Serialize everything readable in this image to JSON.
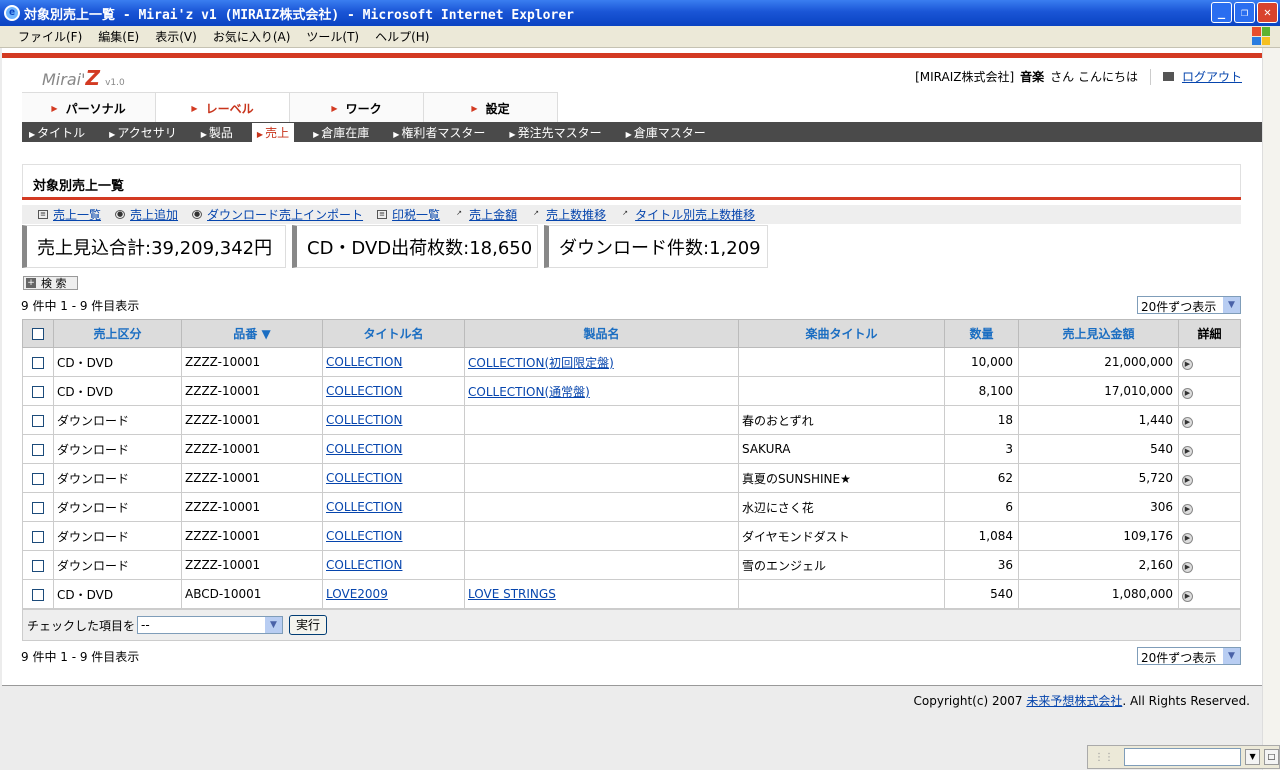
{
  "window": {
    "title": "対象別売上一覧 - Mirai'z v1 (MIRAIZ株式会社) - Microsoft Internet Explorer"
  },
  "menubar": [
    "ファイル(F)",
    "編集(E)",
    "表示(V)",
    "お気に入り(A)",
    "ツール(T)",
    "ヘルプ(H)"
  ],
  "header": {
    "logo_text": "Mirai'",
    "logo_z": "Z",
    "logo_version": "v1.0",
    "company": "[MIRAIZ株式会社]",
    "user": "音楽",
    "greeting": "さん こんにちは",
    "logout": "ログアウト"
  },
  "tabs": [
    "パーソナル",
    "レーベル",
    "ワーク",
    "設定"
  ],
  "active_tab": "レーベル",
  "subnav": [
    "タイトル",
    "アクセサリ",
    "製品",
    "売上",
    "倉庫在庫",
    "権利者マスター",
    "発注先マスター",
    "倉庫マスター"
  ],
  "active_subnav": "売上",
  "page_title": "対象別売上一覧",
  "actions": [
    {
      "label": "売上一覧",
      "icon": "list-icon"
    },
    {
      "label": "売上追加",
      "icon": "add-icon"
    },
    {
      "label": "ダウンロード売上インポート",
      "icon": "import-icon"
    },
    {
      "label": "印税一覧",
      "icon": "list-icon"
    },
    {
      "label": "売上金額",
      "icon": "chart-icon"
    },
    {
      "label": "売上数推移",
      "icon": "chart-icon"
    },
    {
      "label": "タイトル別売上数推移",
      "icon": "chart-icon"
    }
  ],
  "stats": {
    "total_sales": "売上見込合計:39,209,342円",
    "cd_dvd": "CD・DVD出荷枚数:18,650",
    "downloads": "ダウンロード件数:1,209"
  },
  "search_label": "検 索",
  "result_count": "9 件中 1 - 9 件目表示",
  "per_page": "20件ずつ表示",
  "table": {
    "columns": [
      "売上区分",
      "品番 ▼",
      "タイトル名",
      "製品名",
      "楽曲タイトル",
      "数量",
      "売上見込金額",
      "詳細"
    ],
    "rows": [
      {
        "type": "CD・DVD",
        "code": "ZZZZ-10001",
        "title": "COLLECTION",
        "product": "COLLECTION(初回限定盤)",
        "song": "",
        "qty": "10,000",
        "amount": "21,000,000"
      },
      {
        "type": "CD・DVD",
        "code": "ZZZZ-10001",
        "title": "COLLECTION",
        "product": "COLLECTION(通常盤)",
        "song": "",
        "qty": "8,100",
        "amount": "17,010,000"
      },
      {
        "type": "ダウンロード",
        "code": "ZZZZ-10001",
        "title": "COLLECTION",
        "product": "",
        "song": "春のおとずれ",
        "qty": "18",
        "amount": "1,440"
      },
      {
        "type": "ダウンロード",
        "code": "ZZZZ-10001",
        "title": "COLLECTION",
        "product": "",
        "song": "SAKURA",
        "qty": "3",
        "amount": "540"
      },
      {
        "type": "ダウンロード",
        "code": "ZZZZ-10001",
        "title": "COLLECTION",
        "product": "",
        "song": "真夏のSUNSHINE★",
        "qty": "62",
        "amount": "5,720"
      },
      {
        "type": "ダウンロード",
        "code": "ZZZZ-10001",
        "title": "COLLECTION",
        "product": "",
        "song": "水辺にさく花",
        "qty": "6",
        "amount": "306"
      },
      {
        "type": "ダウンロード",
        "code": "ZZZZ-10001",
        "title": "COLLECTION",
        "product": "",
        "song": "ダイヤモンドダスト",
        "qty": "1,084",
        "amount": "109,176"
      },
      {
        "type": "ダウンロード",
        "code": "ZZZZ-10001",
        "title": "COLLECTION",
        "product": "",
        "song": "雪のエンジェル",
        "qty": "36",
        "amount": "2,160"
      },
      {
        "type": "CD・DVD",
        "code": "ABCD-10001",
        "title": "LOVE2009",
        "product": "LOVE STRINGS",
        "song": "",
        "qty": "540",
        "amount": "1,080,000"
      }
    ]
  },
  "bulk": {
    "label": "チェックした項目を",
    "selected": "--",
    "exec": "実行"
  },
  "footer": {
    "copy_prefix": "Copyright(c) 2007",
    "company_link": "未来予想株式会社",
    "copy_suffix": ". All Rights Reserved."
  },
  "colors": {
    "accent": "#d33a22",
    "link": "#0645ad",
    "header_text": "#1b6ec2"
  }
}
